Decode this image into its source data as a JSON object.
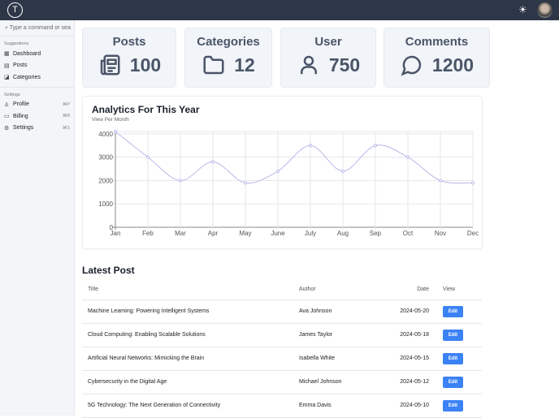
{
  "header": {
    "logo_letter": "T"
  },
  "sidebar": {
    "search_placeholder": "Type a command or sea",
    "sections": [
      {
        "title": "Suggestions",
        "items": [
          {
            "label": "Dashboard",
            "icon": "grid-icon"
          },
          {
            "label": "Posts",
            "icon": "newspaper-icon"
          },
          {
            "label": "Categories",
            "icon": "tags-icon"
          }
        ]
      },
      {
        "title": "Settings",
        "items": [
          {
            "label": "Profile",
            "icon": "user-icon",
            "shortcut": "⌘P"
          },
          {
            "label": "Billing",
            "icon": "credit-card-icon",
            "shortcut": "⌘B"
          },
          {
            "label": "Settings",
            "icon": "gear-icon",
            "shortcut": "⌘S"
          }
        ]
      }
    ]
  },
  "stats": [
    {
      "title": "Posts",
      "value": "100"
    },
    {
      "title": "Categories",
      "value": "12"
    },
    {
      "title": "User",
      "value": "750"
    },
    {
      "title": "Comments",
      "value": "1200"
    }
  ],
  "chart_data": {
    "type": "line",
    "title": "Analytics For This Year",
    "subtitle": "View Per Month",
    "categories": [
      "Jan",
      "Feb",
      "Mar",
      "Apr",
      "May",
      "June",
      "July",
      "Aug",
      "Sep",
      "Oct",
      "Nov",
      "Dec"
    ],
    "values": [
      4100,
      3000,
      2000,
      2800,
      1900,
      2400,
      3500,
      2400,
      3500,
      3000,
      2000,
      1900
    ],
    "yticks": [
      0,
      1000,
      2000,
      3000,
      4000
    ],
    "ylim": [
      0,
      4100
    ],
    "grid": true,
    "color": "#b8b8e8"
  },
  "latest": {
    "title": "Latest Post",
    "columns": [
      "Title",
      "Author",
      "Date",
      "View"
    ],
    "edit_label": "Edit",
    "rows": [
      {
        "title": "Machine Learning: Powering Intelligent Systems",
        "author": "Ava Johnson",
        "date": "2024-05-20"
      },
      {
        "title": "Cloud Computing: Enabling Scalable Solutions",
        "author": "James Taylor",
        "date": "2024-05-18"
      },
      {
        "title": "Artificial Neural Networks: Mimicking the Brain",
        "author": "Isabella White",
        "date": "2024-05-15"
      },
      {
        "title": "Cybersecurity in the Digital Age",
        "author": "Michael Johnson",
        "date": "2024-05-12"
      },
      {
        "title": "5G Technology: The Next Generation of Connectivity",
        "author": "Emma Davis",
        "date": "2024-05-10"
      }
    ]
  }
}
